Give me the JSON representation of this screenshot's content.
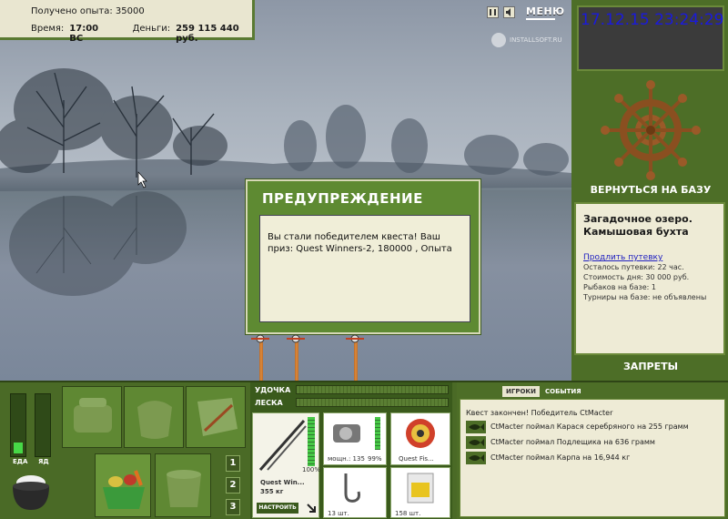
{
  "info": {
    "experience": "Получено опыта: 35000",
    "time_label": "Время:",
    "time_value": "17:00 ВС",
    "money_label": "Деньги:",
    "money_value": "259 115 440 руб."
  },
  "top_controls": {
    "pause_icon": "pause-icon",
    "sound_icon": "sound-icon",
    "menu_label": "МЕНЮ"
  },
  "watermark": "INSTALLSOFT.RU",
  "clock": "17.12.15 23:24:29",
  "right_panel": {
    "return_label": "ВЕРНУТЬСЯ НА БАЗУ",
    "lake_title": "Загадочное озеро. Камышовая бухта",
    "extend_link": "Продлить путевку",
    "stats": [
      "Осталось путевки: 22 час.",
      "Стоимость дня: 30 000 руб.",
      "Рыбаков на базе: 1",
      "Турниры на базе: не объявлены"
    ],
    "bans_label": "ЗАПРЕТЫ"
  },
  "dialog": {
    "title": "ПРЕДУПРЕЖДЕНИЕ",
    "message": "Вы стали победителем квеста! Ваш приз: Quest Winners-2, 180000 , Опыта"
  },
  "needs": {
    "food_label": "ЕДА",
    "poison_label": "ЯД",
    "food_level": 0.2,
    "poison_level": 0
  },
  "inventory": {
    "slot_buttons": [
      "1",
      "2",
      "3"
    ]
  },
  "tackle": {
    "rod_label": "УДОЧКА",
    "line_label": "ЛЕСКА",
    "rod_name": "Quest Win...",
    "rod_weight": "355 кг",
    "rod_percent": "100%",
    "setup_label": "НАСТРОИТЬ",
    "reel_power": "мощн.: 135",
    "reel_percent": "99%",
    "line_name": "Quest Fis...",
    "hook_count": "13 шт.",
    "bait_count": "158 шт."
  },
  "events": {
    "tabs": [
      "ИГРОКИ",
      "СОБЫТИЯ"
    ],
    "items": [
      "Квест закончен! Победитель CtMacter",
      "CtMacter поймал Карася серебряного на 255 грамм",
      "CtMacter поймал Подлещика на 636 грамм",
      "CtMacter поймал Карпа на 16,944 кг"
    ]
  }
}
